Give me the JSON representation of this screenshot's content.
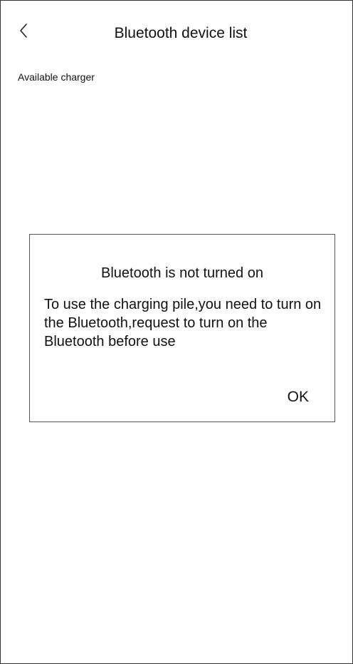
{
  "header": {
    "title": "Bluetooth device list",
    "back_icon": "chevron-left-icon"
  },
  "section": {
    "label": "Available charger"
  },
  "devices": [],
  "dialog": {
    "title": "Bluetooth is not turned on",
    "message": "To use the charging pile,you need to turn on the Bluetooth,request to turn on the Bluetooth before use",
    "ok_label": "OK"
  }
}
